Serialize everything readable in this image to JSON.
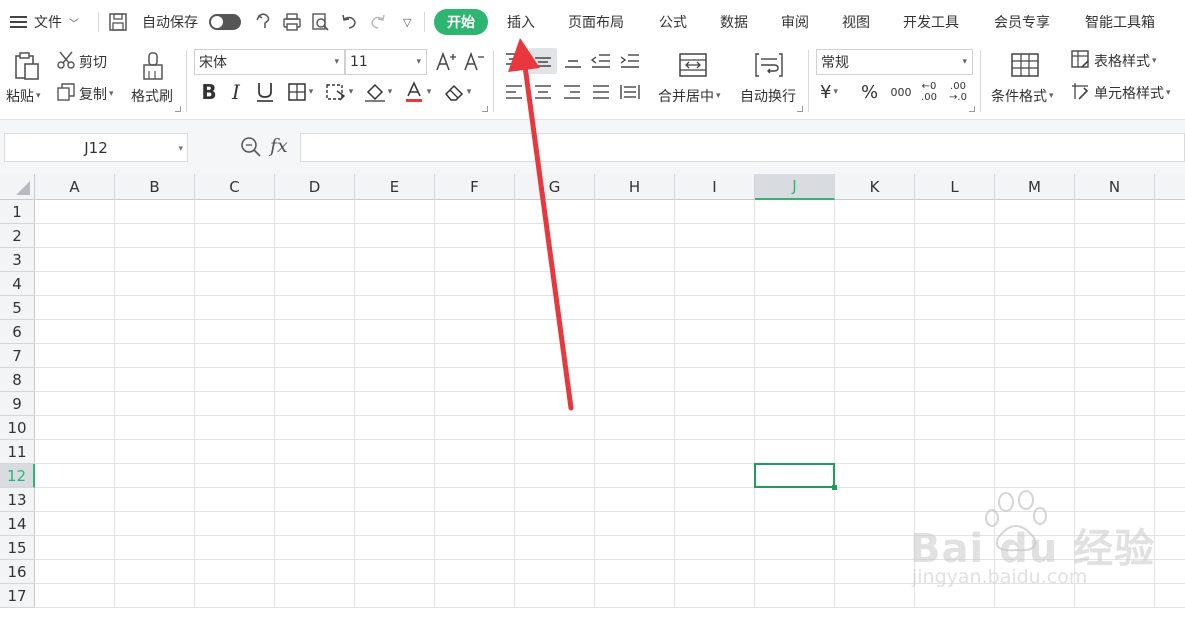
{
  "menubar": {
    "file_label": "文件",
    "autosave_label": "自动保存",
    "tabs": [
      {
        "label": "开始",
        "active": true
      },
      {
        "label": "插入"
      },
      {
        "label": "页面布局"
      },
      {
        "label": "公式"
      },
      {
        "label": "数据"
      },
      {
        "label": "审阅"
      },
      {
        "label": "视图"
      },
      {
        "label": "开发工具"
      },
      {
        "label": "会员专享"
      },
      {
        "label": "智能工具箱"
      }
    ]
  },
  "ribbon": {
    "paste_label": "粘贴",
    "cut_label": "剪切",
    "copy_label": "复制",
    "format_painter_label": "格式刷",
    "font_name": "宋体",
    "font_size": "11",
    "merge_center_label": "合并居中",
    "wrap_text_label": "自动换行",
    "number_format": "常规",
    "currency_symbol": "¥",
    "percent_symbol": "%",
    "thousands_symbol": "000",
    "increase_decimal": "←0 .00",
    "decrease_decimal": ".00 →.0",
    "conditional_format_label": "条件格式",
    "table_style_label": "表格样式",
    "cell_style_label": "单元格样式"
  },
  "formula_bar": {
    "name_box": "J12",
    "fx_label": "fx",
    "formula": ""
  },
  "sheet": {
    "columns": [
      "A",
      "B",
      "C",
      "D",
      "E",
      "F",
      "G",
      "H",
      "I",
      "J",
      "K",
      "L",
      "M",
      "N"
    ],
    "rows": [
      "1",
      "2",
      "3",
      "4",
      "5",
      "6",
      "7",
      "8",
      "9",
      "10",
      "11",
      "12",
      "13",
      "14",
      "15",
      "16",
      "17"
    ],
    "selected_column": "J",
    "selected_row": "12"
  },
  "watermark": {
    "brand": "Bai du 经验",
    "url": "jingyan.baidu.com"
  },
  "colors": {
    "accent": "#2fb572",
    "annotation_arrow": "#e8383d"
  }
}
